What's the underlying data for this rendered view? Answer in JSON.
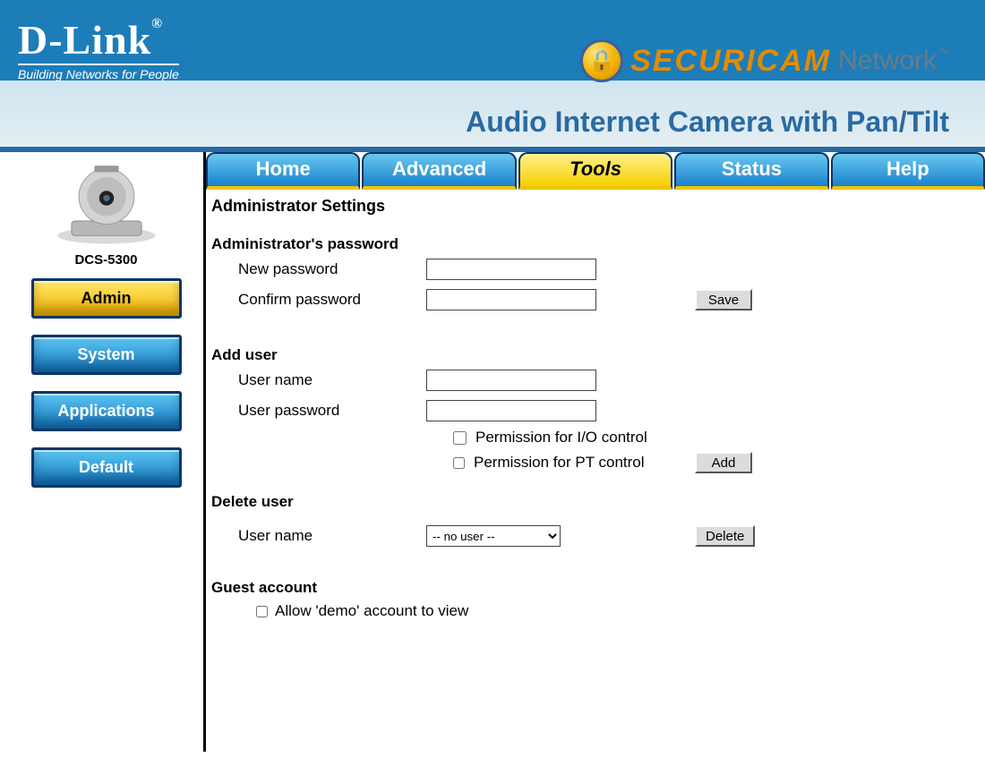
{
  "brand": {
    "name": "D-Link",
    "tagline": "Building Networks for People"
  },
  "product_line": {
    "securi": "SECURI",
    "cam": "CAM",
    "network": "Network",
    "tm": "™",
    "subtitle": "Audio Internet Camera with Pan/Tilt"
  },
  "product_model": "DCS-5300",
  "sidebar": {
    "items": [
      {
        "label": "Admin",
        "active": true
      },
      {
        "label": "System",
        "active": false
      },
      {
        "label": "Applications",
        "active": false
      },
      {
        "label": "Default",
        "active": false
      }
    ]
  },
  "tabs": [
    {
      "label": "Home",
      "active": false
    },
    {
      "label": "Advanced",
      "active": false
    },
    {
      "label": "Tools",
      "active": true
    },
    {
      "label": "Status",
      "active": false
    },
    {
      "label": "Help",
      "active": false
    }
  ],
  "page": {
    "title": "Administrator Settings",
    "admin_pw": {
      "heading": "Administrator's password",
      "new_label": "New password",
      "confirm_label": "Confirm password",
      "save_btn": "Save"
    },
    "add_user": {
      "heading": "Add user",
      "name_label": "User name",
      "pw_label": "User password",
      "perm_io": "Permission for I/O control",
      "perm_pt": "Permission for PT control",
      "add_btn": "Add"
    },
    "delete_user": {
      "heading": "Delete user",
      "name_label": "User name",
      "selected": "-- no user --",
      "delete_btn": "Delete"
    },
    "guest": {
      "heading": "Guest account",
      "allow_label": "Allow 'demo' account to view"
    }
  }
}
